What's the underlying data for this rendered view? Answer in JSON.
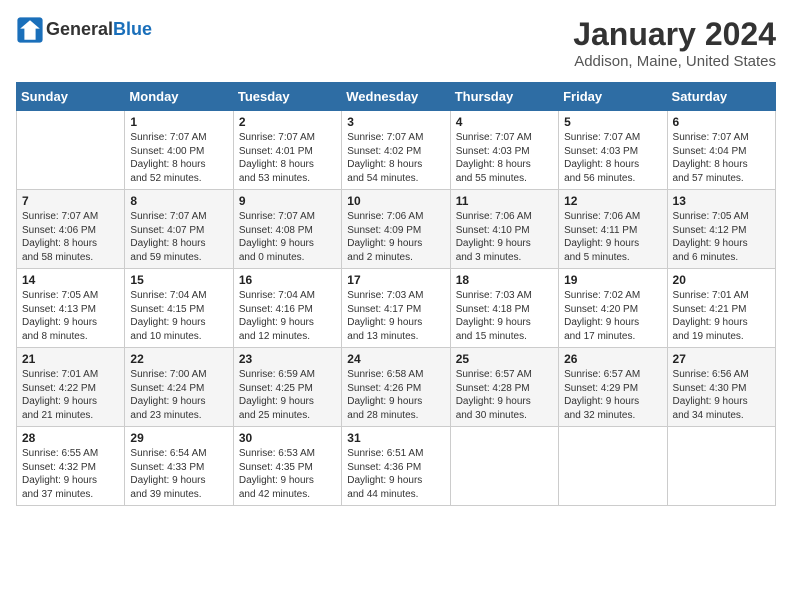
{
  "header": {
    "logo_general": "General",
    "logo_blue": "Blue",
    "title": "January 2024",
    "subtitle": "Addison, Maine, United States"
  },
  "calendar": {
    "days_of_week": [
      "Sunday",
      "Monday",
      "Tuesday",
      "Wednesday",
      "Thursday",
      "Friday",
      "Saturday"
    ],
    "weeks": [
      [
        {
          "day": "",
          "info": ""
        },
        {
          "day": "1",
          "info": "Sunrise: 7:07 AM\nSunset: 4:00 PM\nDaylight: 8 hours\nand 52 minutes."
        },
        {
          "day": "2",
          "info": "Sunrise: 7:07 AM\nSunset: 4:01 PM\nDaylight: 8 hours\nand 53 minutes."
        },
        {
          "day": "3",
          "info": "Sunrise: 7:07 AM\nSunset: 4:02 PM\nDaylight: 8 hours\nand 54 minutes."
        },
        {
          "day": "4",
          "info": "Sunrise: 7:07 AM\nSunset: 4:03 PM\nDaylight: 8 hours\nand 55 minutes."
        },
        {
          "day": "5",
          "info": "Sunrise: 7:07 AM\nSunset: 4:03 PM\nDaylight: 8 hours\nand 56 minutes."
        },
        {
          "day": "6",
          "info": "Sunrise: 7:07 AM\nSunset: 4:04 PM\nDaylight: 8 hours\nand 57 minutes."
        }
      ],
      [
        {
          "day": "7",
          "info": "Sunrise: 7:07 AM\nSunset: 4:06 PM\nDaylight: 8 hours\nand 58 minutes."
        },
        {
          "day": "8",
          "info": "Sunrise: 7:07 AM\nSunset: 4:07 PM\nDaylight: 8 hours\nand 59 minutes."
        },
        {
          "day": "9",
          "info": "Sunrise: 7:07 AM\nSunset: 4:08 PM\nDaylight: 9 hours\nand 0 minutes."
        },
        {
          "day": "10",
          "info": "Sunrise: 7:06 AM\nSunset: 4:09 PM\nDaylight: 9 hours\nand 2 minutes."
        },
        {
          "day": "11",
          "info": "Sunrise: 7:06 AM\nSunset: 4:10 PM\nDaylight: 9 hours\nand 3 minutes."
        },
        {
          "day": "12",
          "info": "Sunrise: 7:06 AM\nSunset: 4:11 PM\nDaylight: 9 hours\nand 5 minutes."
        },
        {
          "day": "13",
          "info": "Sunrise: 7:05 AM\nSunset: 4:12 PM\nDaylight: 9 hours\nand 6 minutes."
        }
      ],
      [
        {
          "day": "14",
          "info": "Sunrise: 7:05 AM\nSunset: 4:13 PM\nDaylight: 9 hours\nand 8 minutes."
        },
        {
          "day": "15",
          "info": "Sunrise: 7:04 AM\nSunset: 4:15 PM\nDaylight: 9 hours\nand 10 minutes."
        },
        {
          "day": "16",
          "info": "Sunrise: 7:04 AM\nSunset: 4:16 PM\nDaylight: 9 hours\nand 12 minutes."
        },
        {
          "day": "17",
          "info": "Sunrise: 7:03 AM\nSunset: 4:17 PM\nDaylight: 9 hours\nand 13 minutes."
        },
        {
          "day": "18",
          "info": "Sunrise: 7:03 AM\nSunset: 4:18 PM\nDaylight: 9 hours\nand 15 minutes."
        },
        {
          "day": "19",
          "info": "Sunrise: 7:02 AM\nSunset: 4:20 PM\nDaylight: 9 hours\nand 17 minutes."
        },
        {
          "day": "20",
          "info": "Sunrise: 7:01 AM\nSunset: 4:21 PM\nDaylight: 9 hours\nand 19 minutes."
        }
      ],
      [
        {
          "day": "21",
          "info": "Sunrise: 7:01 AM\nSunset: 4:22 PM\nDaylight: 9 hours\nand 21 minutes."
        },
        {
          "day": "22",
          "info": "Sunrise: 7:00 AM\nSunset: 4:24 PM\nDaylight: 9 hours\nand 23 minutes."
        },
        {
          "day": "23",
          "info": "Sunrise: 6:59 AM\nSunset: 4:25 PM\nDaylight: 9 hours\nand 25 minutes."
        },
        {
          "day": "24",
          "info": "Sunrise: 6:58 AM\nSunset: 4:26 PM\nDaylight: 9 hours\nand 28 minutes."
        },
        {
          "day": "25",
          "info": "Sunrise: 6:57 AM\nSunset: 4:28 PM\nDaylight: 9 hours\nand 30 minutes."
        },
        {
          "day": "26",
          "info": "Sunrise: 6:57 AM\nSunset: 4:29 PM\nDaylight: 9 hours\nand 32 minutes."
        },
        {
          "day": "27",
          "info": "Sunrise: 6:56 AM\nSunset: 4:30 PM\nDaylight: 9 hours\nand 34 minutes."
        }
      ],
      [
        {
          "day": "28",
          "info": "Sunrise: 6:55 AM\nSunset: 4:32 PM\nDaylight: 9 hours\nand 37 minutes."
        },
        {
          "day": "29",
          "info": "Sunrise: 6:54 AM\nSunset: 4:33 PM\nDaylight: 9 hours\nand 39 minutes."
        },
        {
          "day": "30",
          "info": "Sunrise: 6:53 AM\nSunset: 4:35 PM\nDaylight: 9 hours\nand 42 minutes."
        },
        {
          "day": "31",
          "info": "Sunrise: 6:51 AM\nSunset: 4:36 PM\nDaylight: 9 hours\nand 44 minutes."
        },
        {
          "day": "",
          "info": ""
        },
        {
          "day": "",
          "info": ""
        },
        {
          "day": "",
          "info": ""
        }
      ]
    ]
  }
}
